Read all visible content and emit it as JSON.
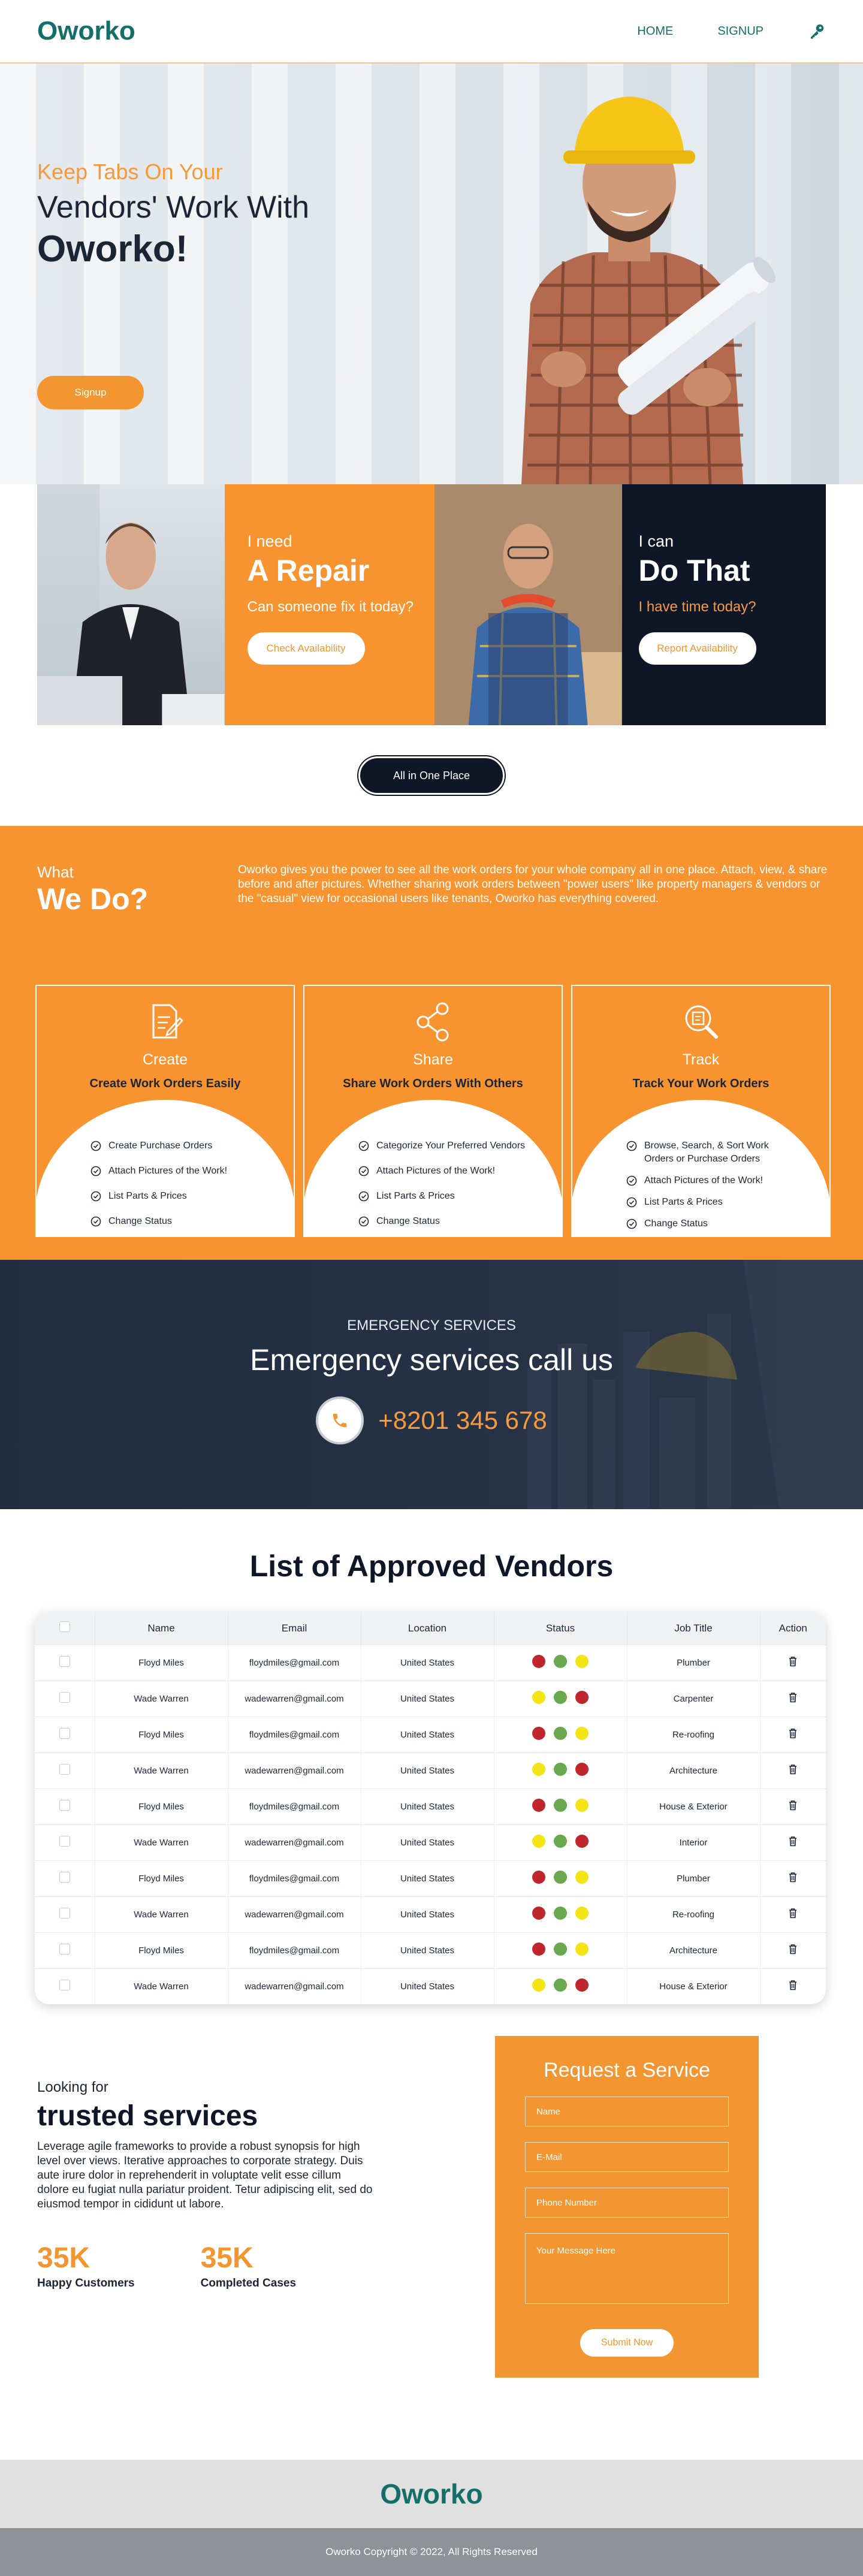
{
  "nav": {
    "logo": "Oworko",
    "home": "HOME",
    "signup": "SIGNUP",
    "key_icon": "key-icon"
  },
  "hero": {
    "kicker": "Keep Tabs On Your",
    "line2": "Vendors' Work With",
    "line3": "Oworko!",
    "button": "Signup"
  },
  "tiles": {
    "repair": {
      "small": "I need",
      "big": "A Repair",
      "sub": "Can someone fix it today?",
      "button": "Check Availability"
    },
    "do_that": {
      "small": "I can",
      "big": "Do That",
      "sub": "I have time today?",
      "button": "Report Availability"
    }
  },
  "all_in_one": "All in One Place",
  "what_we_do": {
    "small": "What",
    "big": "We Do?",
    "description": "Oworko gives you the power to see all the work orders for your whole company all in one place. Attach, view, & share before and after pictures. Whether sharing work orders between \"power users\" like property managers & vendors or the \"casual\" view for occasional users like tenants, Oworko has everything covered.",
    "cards": [
      {
        "name": "Create",
        "heading": "Create Work Orders Easily",
        "items": [
          "Create Purchase Orders",
          "Attach Pictures of the Work!",
          "List Parts & Prices",
          "Change Status"
        ]
      },
      {
        "name": "Share",
        "heading": "Share Work Orders With Others",
        "items": [
          "Categorize Your Preferred Vendors",
          "Attach Pictures of the Work!",
          "List Parts & Prices",
          "Change Status"
        ]
      },
      {
        "name": "Track",
        "heading": "Track Your Work Orders",
        "items": [
          "Browse, Search, & Sort Work Orders or Purchase Orders",
          "Attach Pictures of the Work!",
          "List Parts & Prices",
          "Change Status"
        ]
      }
    ]
  },
  "emergency": {
    "kicker": "EMERGENCY SERVICES",
    "title": "Emergency services call us",
    "phone": "+8201 345 678"
  },
  "vendors": {
    "title": "List of Approved Vendors",
    "columns": [
      "Name",
      "Email",
      "Location",
      "Status",
      "Job Title",
      "Action"
    ],
    "rows": [
      {
        "name": "Floyd Miles",
        "email": "floydmiles@gmail.com",
        "location": "United States",
        "status": [
          "red",
          "green",
          "yellow"
        ],
        "job": "Plumber"
      },
      {
        "name": "Wade Warren",
        "email": "wadewarren@gmail.com",
        "location": "United States",
        "status": [
          "yellow",
          "green",
          "red"
        ],
        "job": "Carpenter"
      },
      {
        "name": "Floyd Miles",
        "email": "floydmiles@gmail.com",
        "location": "United States",
        "status": [
          "red",
          "green",
          "yellow"
        ],
        "job": "Re-roofing"
      },
      {
        "name": "Wade Warren",
        "email": "wadewarren@gmail.com",
        "location": "United States",
        "status": [
          "yellow",
          "green",
          "red"
        ],
        "job": "Architecture"
      },
      {
        "name": "Floyd Miles",
        "email": "floydmiles@gmail.com",
        "location": "United States",
        "status": [
          "red",
          "green",
          "yellow"
        ],
        "job": "House & Exterior"
      },
      {
        "name": "Wade Warren",
        "email": "wadewarren@gmail.com",
        "location": "United States",
        "status": [
          "yellow",
          "green",
          "red"
        ],
        "job": "Interior"
      },
      {
        "name": "Floyd Miles",
        "email": "floydmiles@gmail.com",
        "location": "United States",
        "status": [
          "red",
          "green",
          "yellow"
        ],
        "job": "Plumber"
      },
      {
        "name": "Wade Warren",
        "email": "wadewarren@gmail.com",
        "location": "United States",
        "status": [
          "red",
          "green",
          "yellow"
        ],
        "job": "Re-roofing"
      },
      {
        "name": "Floyd Miles",
        "email": "floydmiles@gmail.com",
        "location": "United States",
        "status": [
          "red",
          "green",
          "yellow"
        ],
        "job": "Architecture"
      },
      {
        "name": "Wade Warren",
        "email": "wadewarren@gmail.com",
        "location": "United States",
        "status": [
          "yellow",
          "green",
          "red"
        ],
        "job": "House & Exterior"
      }
    ],
    "status_colors": {
      "red": "#c0272d",
      "green": "#6aa84f",
      "yellow": "#f4e416"
    }
  },
  "trusted": {
    "kicker": "Looking for",
    "title": "trusted services",
    "description": "Leverage agile frameworks to provide a robust synopsis for high level over views. Iterative approaches to corporate strategy. Duis aute irure dolor in reprehenderit in voluptate velit esse cillum dolore eu fugiat nulla pariatur proident. Tetur adipiscing elit, sed do eiusmod tempor in cididunt ut labore.",
    "stats": [
      {
        "value": "35K",
        "label": "Happy Customers"
      },
      {
        "value": "35K",
        "label": "Completed Cases"
      }
    ]
  },
  "form": {
    "title": "Request a Service",
    "name_placeholder": "Name",
    "email_placeholder": "E-Mail",
    "phone_placeholder": "Phone Number",
    "message_placeholder": "Your Message Here",
    "submit": "Submit Now"
  },
  "footer": {
    "logo": "Oworko",
    "copyright": "Oworko Copyright © 2022, All Rights Reserved"
  },
  "colors": {
    "accent": "#f39530",
    "navy": "#0e1628",
    "brand": "#146f6a"
  }
}
